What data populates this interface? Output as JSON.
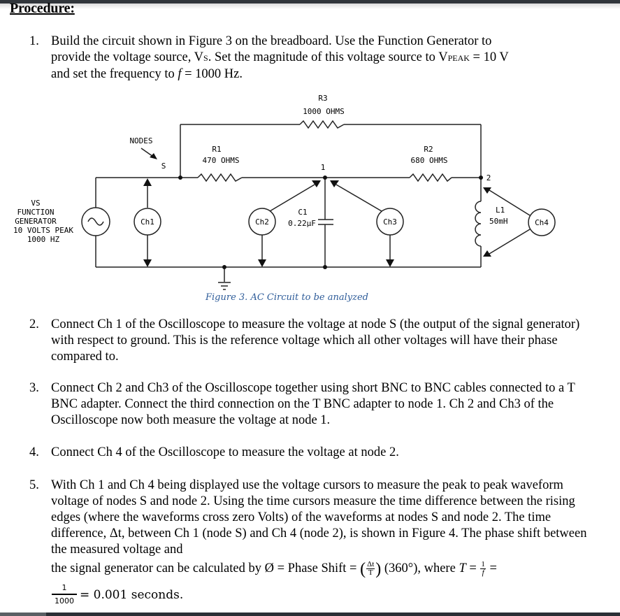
{
  "heading": "Procedure:",
  "steps": [
    {
      "num": "1.",
      "lines": [
        "Build the circuit shown in Figure 3 on the breadboard. Use the Function Generator to",
        "provide the voltage source, V",
        "S",
        ". Set the magnitude of this voltage source to V",
        "PEAK",
        " = 10 V",
        "and set the frequency to ",
        "f",
        " = 1000 Hz."
      ]
    },
    {
      "num": "2.",
      "text": "Connect Ch 1 of the Oscilloscope to measure the voltage at node S (the output of the signal generator) with respect to ground. This is the reference voltage which all other voltages will have their phase compared to."
    },
    {
      "num": "3.",
      "text": "Connect Ch 2 and Ch3 of the Oscilloscope together using short BNC to BNC cables connected to a T BNC adapter. Connect the third connection on the T BNC adapter to node 1. Ch 2 and Ch3 of the Oscilloscope now both measure the voltage at node 1."
    },
    {
      "num": "4.",
      "text": "Connect Ch 4 of the Oscilloscope to measure the voltage at node 2."
    },
    {
      "num": "5.",
      "text": "With Ch 1 and Ch 4 being displayed use the voltage cursors to measure the peak to peak waveform voltage of nodes S and node 2. Using the time cursors measure the time difference between the rising edges (where the waveforms cross zero Volts) of the waveforms at nodes S and node 2. The time difference, Δt, between Ch 1 (node S) and Ch 4 (node 2), is shown in Figure 4. The phase shift between the measured voltage and",
      "formula_lead": "the signal generator can be calculated by Ø = Phase Shift = ",
      "formula_num": "Δt",
      "formula_den": "T",
      "formula_mid": " (360°),  where ",
      "formula_T": "T",
      "formula_eq": " = ",
      "formula_f_num": "1",
      "formula_f_den": "f",
      "formula_end": " =",
      "last_num": "1",
      "last_den": "1000",
      "last_tail": "= 0.001 seconds."
    }
  ],
  "figure": {
    "caption": "Figure 3. AC Circuit to be analyzed",
    "labels": {
      "source": [
        "VS",
        "FUNCTION",
        "GENERATOR",
        "10 VOLTS PEAK",
        "1000 HZ"
      ],
      "nodes": "NODES",
      "node_s": "S",
      "node_1": "1",
      "node_2": "2",
      "r1_name": "R1",
      "r1_value": "470 OHMS",
      "r2_name": "R2",
      "r2_value": "680 OHMS",
      "r3_name": "R3",
      "r3_value": "1000 OHMS",
      "c1_name": "C1",
      "c1_value": "0.22µF",
      "l1_name": "L1",
      "l1_value": "50mH",
      "ch1": "Ch1",
      "ch2": "Ch2",
      "ch3": "Ch3",
      "ch4": "Ch4"
    }
  }
}
